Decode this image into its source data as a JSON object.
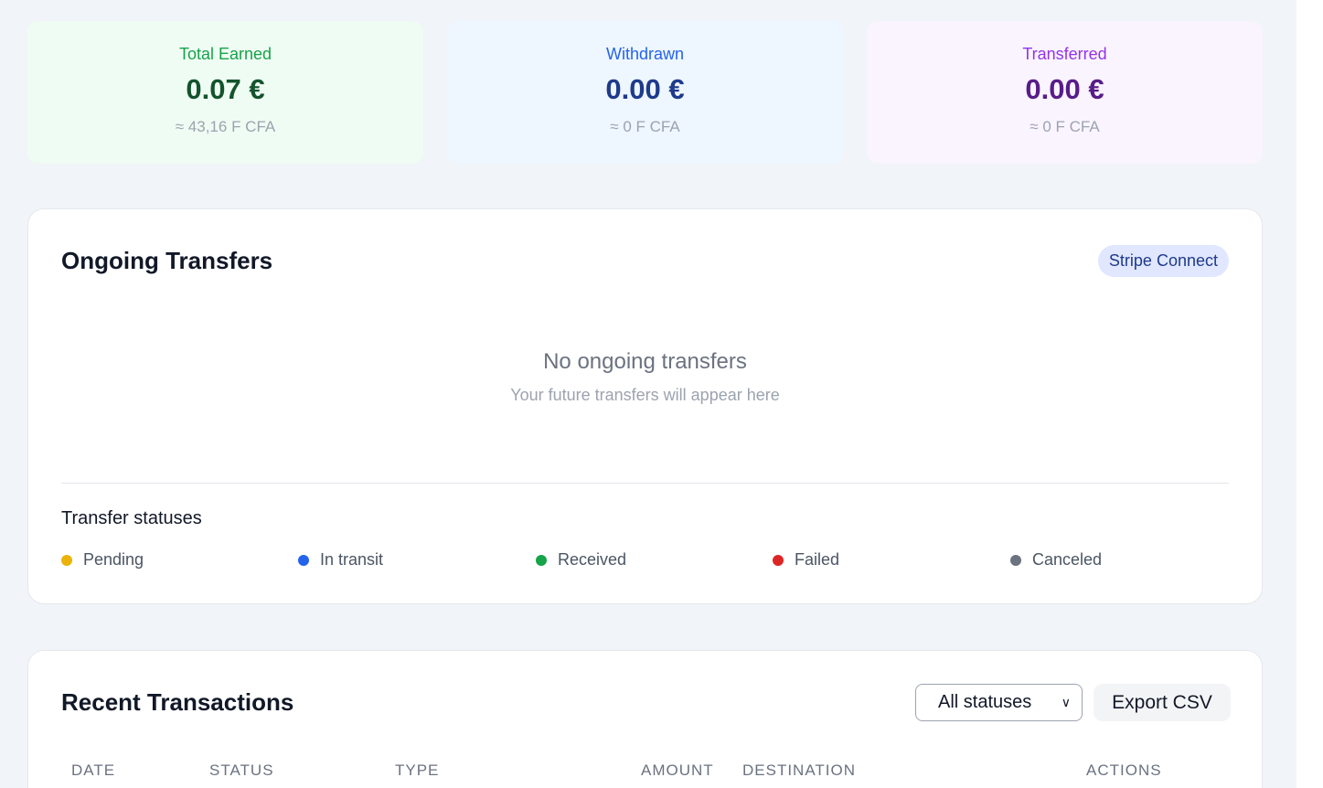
{
  "stats": {
    "earned": {
      "label": "Total Earned",
      "value": "0.07 €",
      "sub": "≈ 43,16 F CFA",
      "label_color": "#16a34a",
      "value_color": "#14532d"
    },
    "withdrawn": {
      "label": "Withdrawn",
      "value": "0.00 €",
      "sub": "≈ 0 F CFA",
      "label_color": "#2563eb",
      "value_color": "#1e3a8a"
    },
    "transferred": {
      "label": "Transferred",
      "value": "0.00 €",
      "sub": "≈ 0 F CFA",
      "label_color": "#9333ea",
      "value_color": "#581c87"
    }
  },
  "transfers": {
    "title": "Ongoing Transfers",
    "badge": "Stripe Connect",
    "empty_title": "No ongoing transfers",
    "empty_sub": "Your future transfers will appear here",
    "legend_title": "Transfer statuses",
    "legend": [
      {
        "label": "Pending",
        "color": "#eab308"
      },
      {
        "label": "In transit",
        "color": "#2563eb"
      },
      {
        "label": "Received",
        "color": "#16a34a"
      },
      {
        "label": "Failed",
        "color": "#dc2626"
      },
      {
        "label": "Canceled",
        "color": "#6b7280"
      }
    ]
  },
  "transactions": {
    "title": "Recent Transactions",
    "status_filter": "All statuses",
    "export_label": "Export CSV",
    "columns": [
      "DATE",
      "STATUS",
      "TYPE",
      "AMOUNT",
      "DESTINATION",
      "ACTIONS"
    ]
  }
}
